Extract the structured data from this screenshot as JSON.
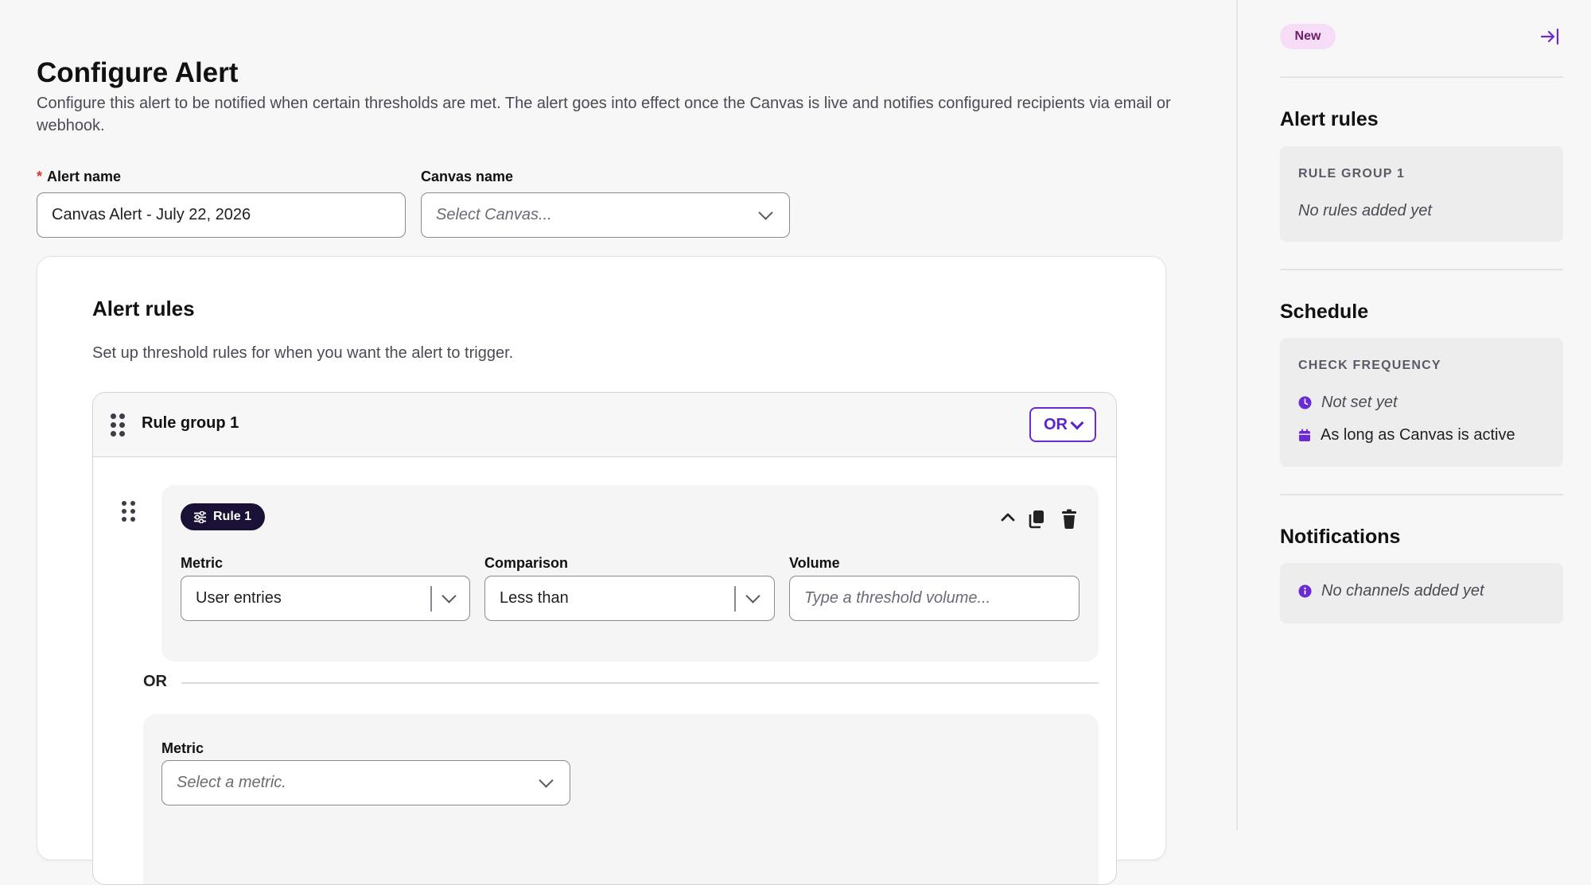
{
  "page": {
    "title": "Configure Alert",
    "description": "Configure this alert to be notified when certain thresholds are met. The alert goes into effect once the Canvas is live and notifies configured recipients via email or webhook."
  },
  "form": {
    "alert_name_label": "Alert name",
    "alert_name_required_mark": "*",
    "alert_name_value": "Canvas Alert - July 22, 2026",
    "canvas_name_label": "Canvas name",
    "canvas_name_placeholder": "Select Canvas..."
  },
  "alert_rules": {
    "title": "Alert rules",
    "description": "Set up threshold rules for when you want the alert to trigger.",
    "group": {
      "title": "Rule group 1",
      "operator": "OR",
      "rules": [
        {
          "label": "Rule 1",
          "metric_label": "Metric",
          "metric_value": "User entries",
          "comparison_label": "Comparison",
          "comparison_value": "Less than",
          "volume_label": "Volume",
          "volume_placeholder": "Type a threshold volume..."
        }
      ],
      "separator": "OR",
      "new_rule": {
        "metric_label": "Metric",
        "metric_placeholder": "Select a metric."
      }
    }
  },
  "sidebar": {
    "badge": "New",
    "alert_rules_heading": "Alert rules",
    "rule_group_caption": "RULE GROUP 1",
    "rule_group_empty": "No rules added yet",
    "schedule_heading": "Schedule",
    "check_frequency_caption": "CHECK FREQUENCY",
    "frequency_value": "Not set yet",
    "duration_value": "As long as Canvas is active",
    "notifications_heading": "Notifications",
    "notifications_empty": "No channels added yet"
  },
  "icons": {
    "drag": "drag-handle-icon",
    "chevron": "chevron-down-icon",
    "collapse_rule": "chevron-up-icon",
    "duplicate": "copy-icon",
    "delete": "trash-icon",
    "rule": "sliders-icon",
    "clock": "clock-icon",
    "calendar": "calendar-icon",
    "info": "info-icon",
    "collapse_panel": "collapse-panel-icon"
  },
  "colors": {
    "accent": "#6b2bd4",
    "rule_pill": "#1b1035",
    "new_badge_bg": "#f6dcf6",
    "required": "#d5372f"
  }
}
